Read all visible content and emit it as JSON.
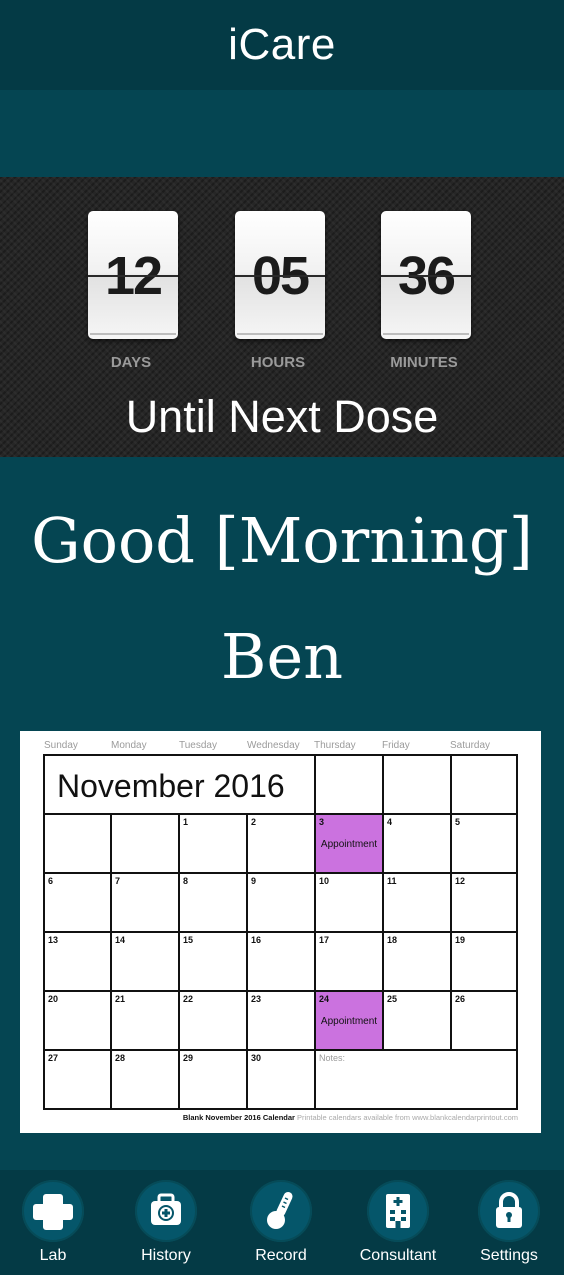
{
  "header": {
    "title": "iCare"
  },
  "countdown": {
    "units": [
      {
        "value": "12",
        "label": "DAYS"
      },
      {
        "value": "05",
        "label": "HOURS"
      },
      {
        "value": "36",
        "label": "MINUTES"
      }
    ],
    "caption": "Until Next Dose"
  },
  "greeting": {
    "line": "Good [Morning]",
    "name": "Ben"
  },
  "calendar": {
    "title": "November 2016",
    "day_names": [
      "Sunday",
      "Monday",
      "Tuesday",
      "Wednesday",
      "Thursday",
      "Friday",
      "Saturday"
    ],
    "dates": [
      "1",
      "2",
      "3",
      "4",
      "5",
      "6",
      "7",
      "8",
      "9",
      "10",
      "11",
      "12",
      "13",
      "14",
      "15",
      "16",
      "17",
      "18",
      "19",
      "20",
      "21",
      "22",
      "23",
      "24",
      "25",
      "26",
      "27",
      "28",
      "29",
      "30"
    ],
    "appointments": [
      {
        "date": "3",
        "label": "Appointment"
      },
      {
        "date": "24",
        "label": "Appointment"
      }
    ],
    "appointment_color": "#cb72df",
    "notes_label": "Notes:",
    "footer_bold": "Blank November 2016 Calendar",
    "footer_light": "Printable calendars available from www.blankcalendarprintout.com"
  },
  "tabs": [
    {
      "label": "Lab",
      "icon": "plus-cross-icon"
    },
    {
      "label": "History",
      "icon": "medical-bag-icon"
    },
    {
      "label": "Record",
      "icon": "thermometer-icon"
    },
    {
      "label": "Consultant",
      "icon": "hospital-building-icon"
    },
    {
      "label": "Settings",
      "icon": "lock-icon"
    }
  ],
  "colors": {
    "background": "#054552",
    "header": "#043a45",
    "countdown_panel": "#262626"
  }
}
